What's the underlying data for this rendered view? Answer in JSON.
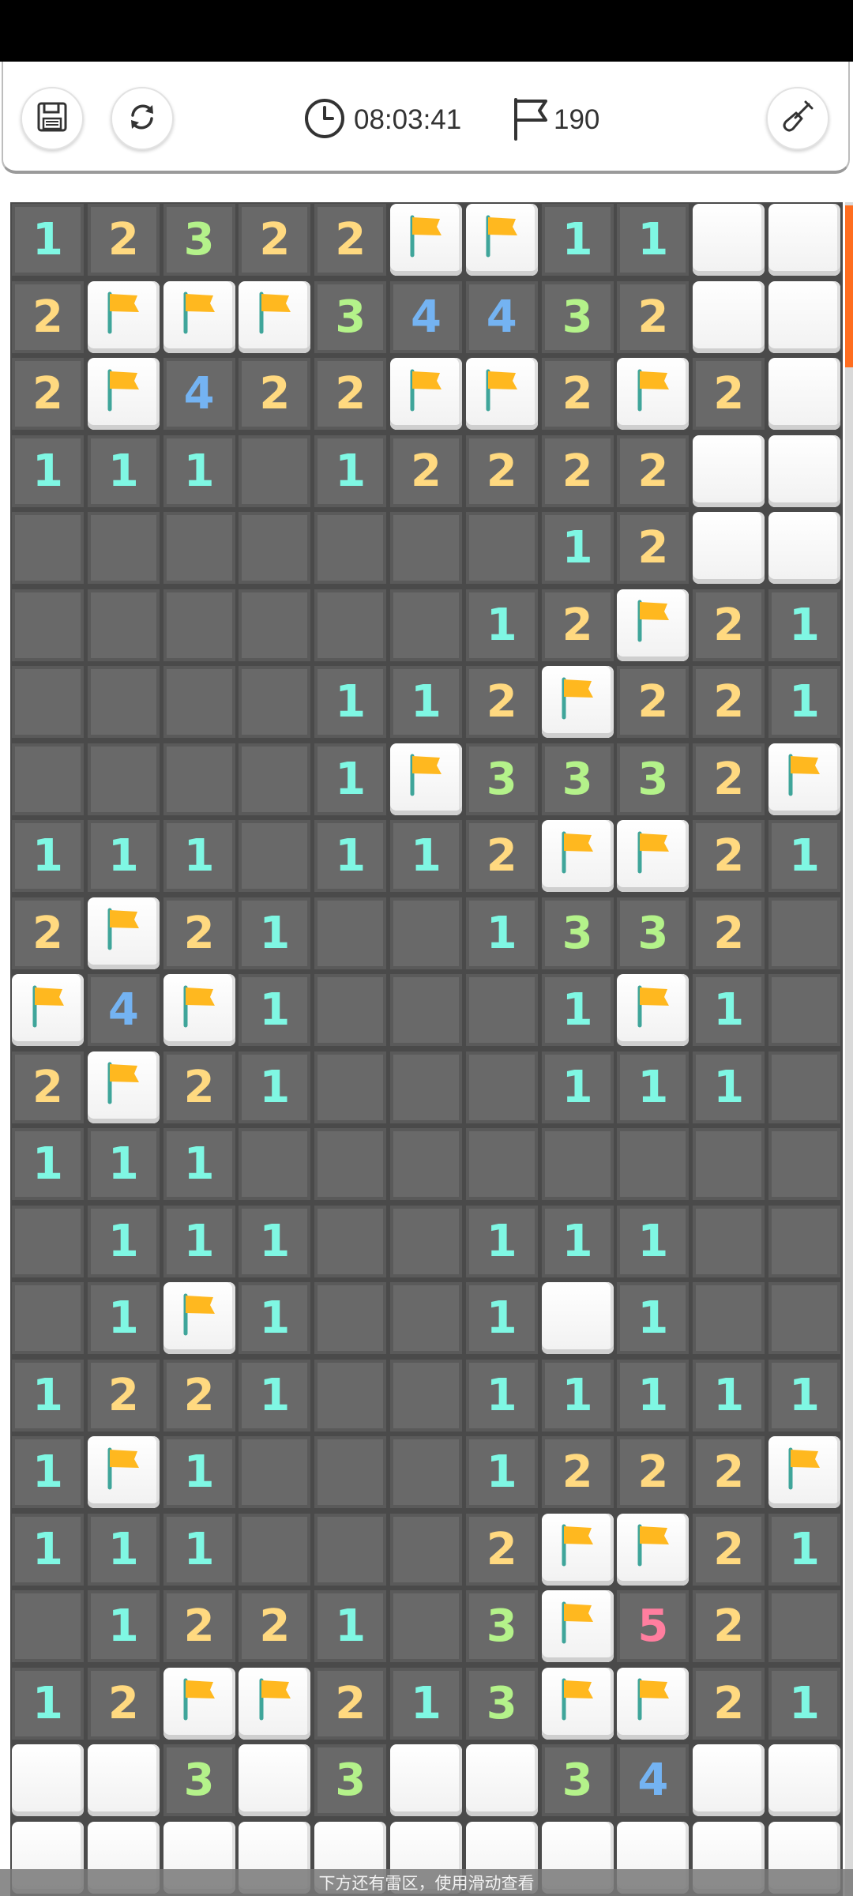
{
  "toolbar": {
    "save_icon": "save-icon",
    "restart_icon": "restart-icon",
    "tool_icon": "shovel-icon",
    "timer": "08:03:41",
    "flag_count": "190"
  },
  "board": {
    "columns": 11,
    "rows": [
      [
        "1",
        "2",
        "3",
        "2",
        "2",
        "F",
        "F",
        "1",
        "1",
        "H",
        "H"
      ],
      [
        "2",
        "F",
        "F",
        "F",
        "3",
        "4",
        "4",
        "3",
        "2",
        "H",
        "H"
      ],
      [
        "2",
        "F",
        "4",
        "2",
        "2",
        "F",
        "F",
        "2",
        "F",
        "2",
        "H"
      ],
      [
        "1",
        "1",
        "1",
        "",
        "1",
        "2",
        "2",
        "2",
        "2",
        "H",
        "H"
      ],
      [
        "",
        "",
        "",
        "",
        "",
        "",
        "",
        "1",
        "2",
        "H",
        "H"
      ],
      [
        "",
        "",
        "",
        "",
        "",
        "",
        "1",
        "2",
        "F",
        "2",
        "1"
      ],
      [
        "",
        "",
        "",
        "",
        "1",
        "1",
        "2",
        "F",
        "2",
        "2",
        "1"
      ],
      [
        "",
        "",
        "",
        "",
        "1",
        "F",
        "3",
        "3",
        "3",
        "2",
        "F"
      ],
      [
        "1",
        "1",
        "1",
        "",
        "1",
        "1",
        "2",
        "F",
        "F",
        "2",
        "1"
      ],
      [
        "2",
        "F",
        "2",
        "1",
        "",
        "",
        "1",
        "3",
        "3",
        "2",
        ""
      ],
      [
        "F",
        "4",
        "F",
        "1",
        "",
        "",
        "",
        "1",
        "F",
        "1",
        ""
      ],
      [
        "2",
        "F",
        "2",
        "1",
        "",
        "",
        "",
        "1",
        "1",
        "1",
        ""
      ],
      [
        "1",
        "1",
        "1",
        "",
        "",
        "",
        "",
        "",
        "",
        "",
        ""
      ],
      [
        "",
        "1",
        "1",
        "1",
        "",
        "",
        "1",
        "1",
        "1",
        "",
        ""
      ],
      [
        "",
        "1",
        "F",
        "1",
        "",
        "",
        "1",
        "H",
        "1",
        "",
        ""
      ],
      [
        "1",
        "2",
        "2",
        "1",
        "",
        "",
        "1",
        "1",
        "1",
        "1",
        "1"
      ],
      [
        "1",
        "F",
        "1",
        "",
        "",
        "",
        "1",
        "2",
        "2",
        "2",
        "F"
      ],
      [
        "1",
        "1",
        "1",
        "",
        "",
        "",
        "2",
        "F",
        "F",
        "2",
        "1"
      ],
      [
        "",
        "1",
        "2",
        "2",
        "1",
        "",
        "3",
        "F",
        "5",
        "2",
        ""
      ],
      [
        "1",
        "2",
        "F",
        "F",
        "2",
        "1",
        "3",
        "F",
        "F",
        "2",
        "1"
      ],
      [
        "H",
        "H",
        "3",
        "H",
        "3",
        "H",
        "H",
        "3",
        "4",
        "H",
        "H"
      ],
      [
        "H",
        "H",
        "H",
        "H",
        "H",
        "H",
        "H",
        "H",
        "H",
        "H",
        "H"
      ]
    ],
    "number_colors": {
      "1": "#7ff7e3",
      "2": "#ffd980",
      "3": "#b4f28a",
      "4": "#74b3f2",
      "5": "#ff7e9f"
    },
    "flag_color": "#ffb81f",
    "flagpole_color": "#3fa59a"
  },
  "hint": "下方还有雷区，使用滑动查看",
  "colors": {
    "accent": "#ff6d1f",
    "board_bg": "#4a4a4a",
    "open_cell": "#696969"
  }
}
